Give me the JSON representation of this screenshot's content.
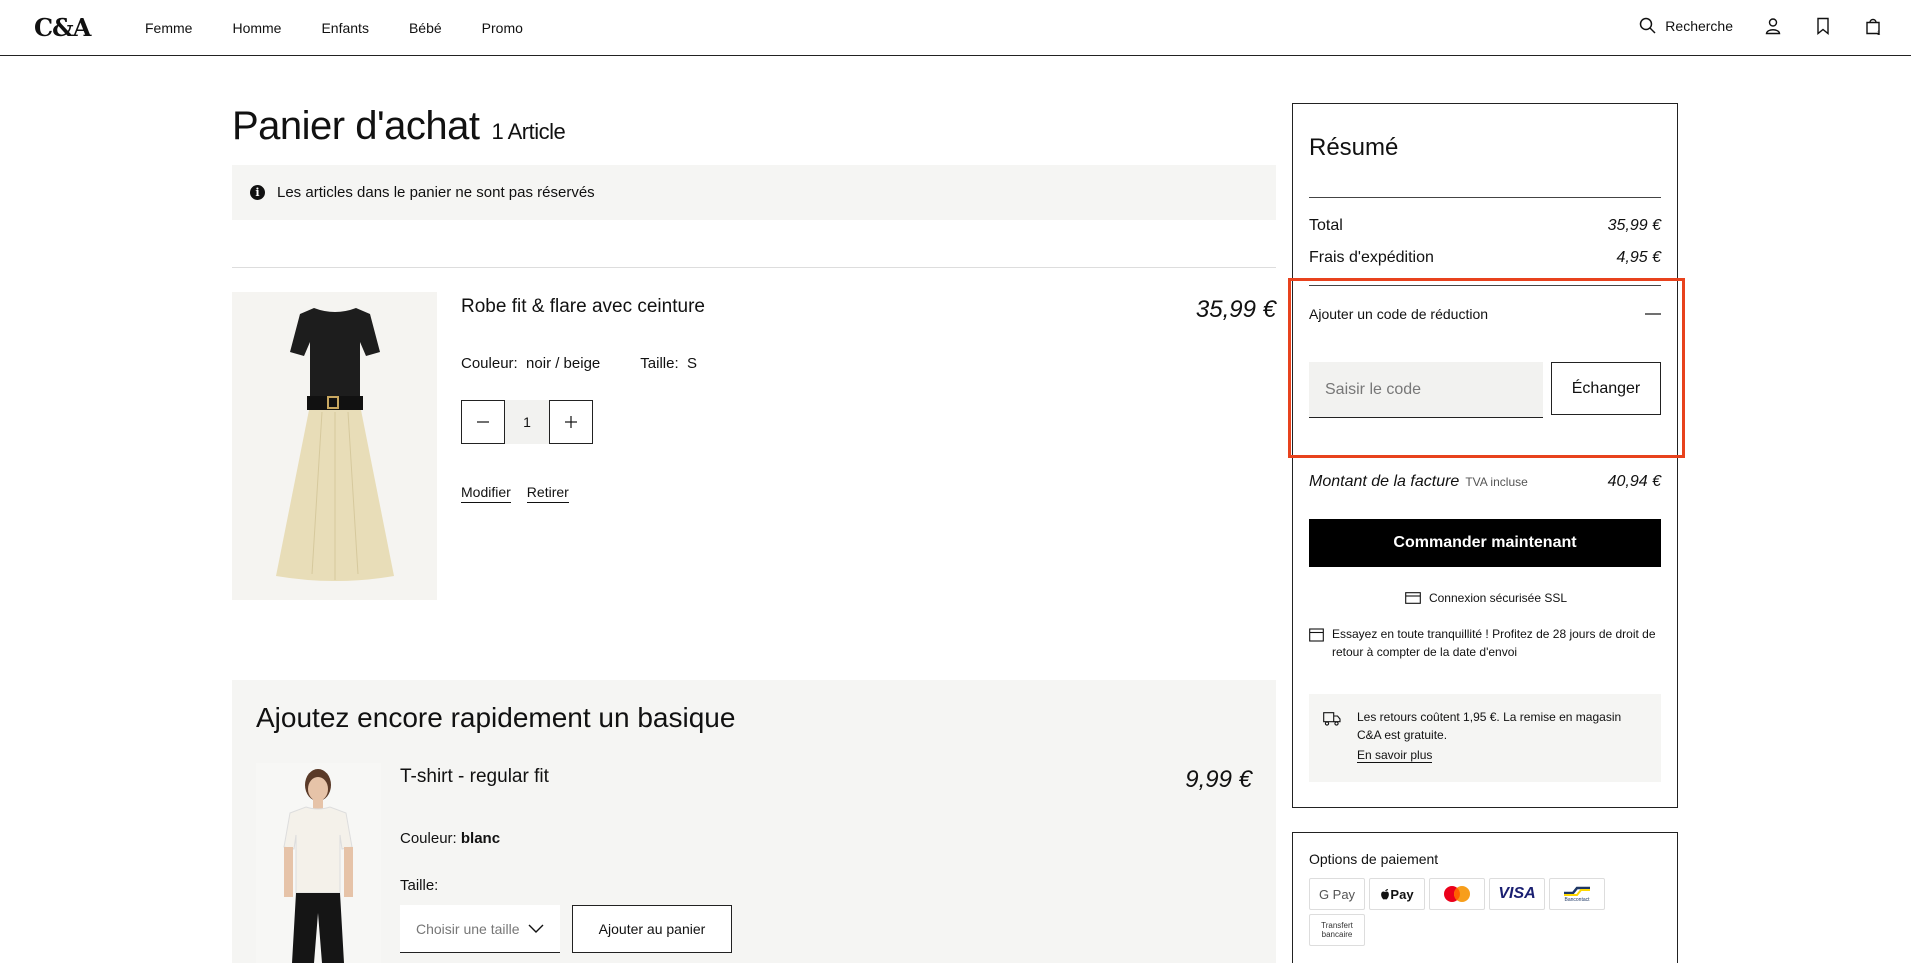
{
  "header": {
    "logo": "C&A",
    "nav": [
      "Femme",
      "Homme",
      "Enfants",
      "Bébé",
      "Promo"
    ],
    "search_label": "Recherche"
  },
  "cart": {
    "title": "Panier d'achat",
    "count": "1 Article",
    "notice": "Les articles dans le panier ne sont pas réservés"
  },
  "product": {
    "name": "Robe fit & flare avec ceinture",
    "price": "35,99 €",
    "color_label": "Couleur:",
    "color_value": "noir / beige",
    "size_label": "Taille:",
    "size_value": "S",
    "quantity": "1",
    "modify": "Modifier",
    "remove": "Retirer"
  },
  "upsell": {
    "title": "Ajoutez encore rapidement un basique",
    "name": "T-shirt - regular fit",
    "price": "9,99 €",
    "color_label": "Couleur:",
    "color_value": "blanc",
    "size_label": "Taille:",
    "size_placeholder": "Choisir une taille",
    "add_button": "Ajouter au panier"
  },
  "summary": {
    "title": "Résumé",
    "total_label": "Total",
    "total_value": "35,99 €",
    "shipping_label": "Frais d'expédition",
    "shipping_value": "4,95 €",
    "promo_label": "Ajouter un code de réduction",
    "promo_placeholder": "Saisir le code",
    "promo_button": "Échanger",
    "invoice_label": "Montant de la facture",
    "invoice_tva": "TVA incluse",
    "invoice_value": "40,94 €",
    "order_button": "Commander maintenant",
    "ssl": "Connexion sécurisée SSL",
    "return_policy": "Essayez en toute tranquillité ! Profitez de 28 jours de droit de retour à compter de la date d'envoi",
    "returns_cost": "Les retours coûtent 1,95 €. La remise en magasin C&A est gratuite.",
    "learn_more": "En savoir plus"
  },
  "payment": {
    "title": "Options de paiement",
    "methods": [
      "G Pay",
      "Pay",
      "",
      "VISA",
      "Bancontact"
    ],
    "transfer": "Transfert bancaire"
  },
  "colors": {
    "highlight": "#e8421d",
    "primary": "#000000",
    "panel": "#f5f5f3"
  }
}
